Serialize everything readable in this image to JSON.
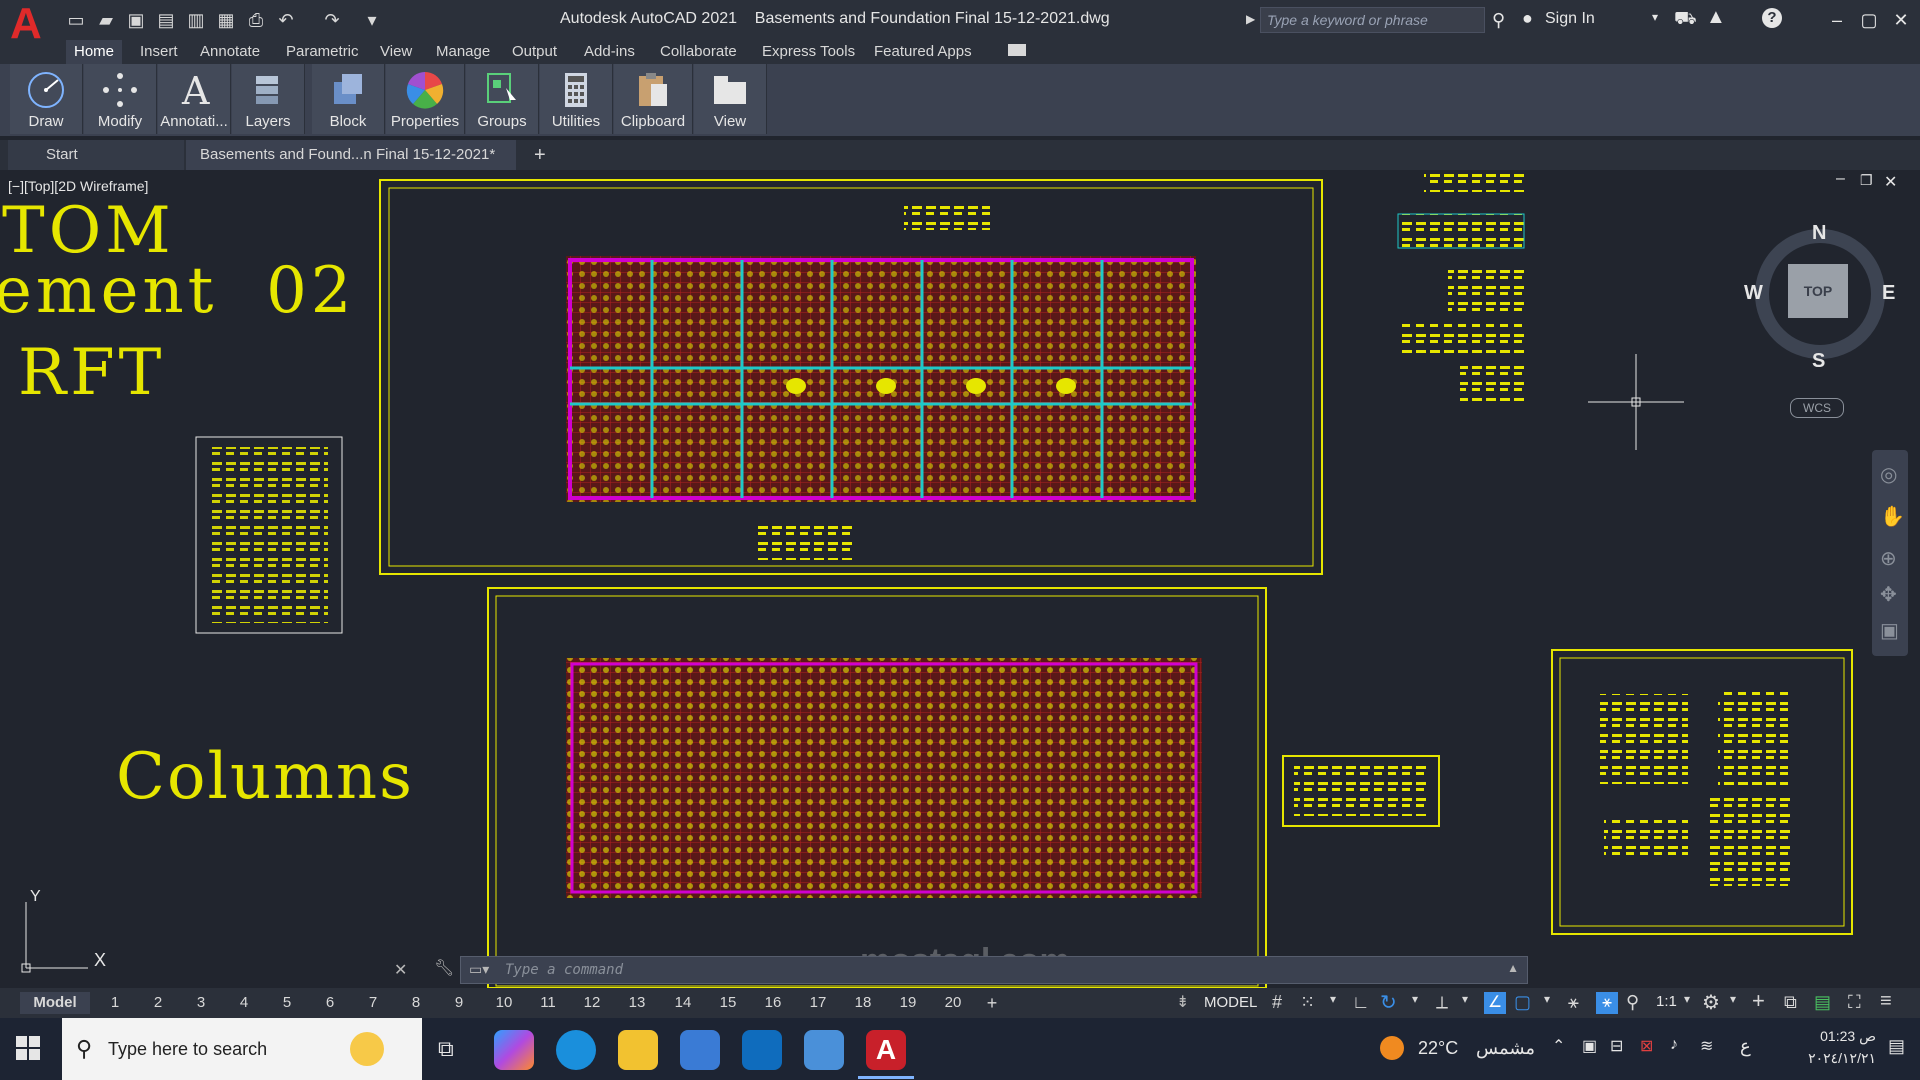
{
  "titlebar": {
    "app_title": "Autodesk AutoCAD 2021",
    "file_title": "Basements and Foundation Final 15-12-2021.dwg",
    "search_placeholder": "Type a keyword or phrase",
    "signin": "Sign In"
  },
  "ribbon_tabs": [
    "Home",
    "Insert",
    "Annotate",
    "Parametric",
    "View",
    "Manage",
    "Output",
    "Add-ins",
    "Collaborate",
    "Express Tools",
    "Featured Apps"
  ],
  "ribbon_panels": [
    {
      "label": "Draw",
      "icon": "draw-icon"
    },
    {
      "label": "Modify",
      "icon": "modify-icon"
    },
    {
      "label": "Annotati...",
      "icon": "annotation-icon"
    },
    {
      "label": "Layers",
      "icon": "layers-icon"
    },
    {
      "label": "Block",
      "icon": "block-icon"
    },
    {
      "label": "Properties",
      "icon": "properties-icon"
    },
    {
      "label": "Groups",
      "icon": "groups-icon"
    },
    {
      "label": "Utilities",
      "icon": "utilities-icon"
    },
    {
      "label": "Clipboard",
      "icon": "clipboard-icon"
    },
    {
      "label": "View",
      "icon": "view-icon"
    }
  ],
  "file_tabs": {
    "start": "Start",
    "active": "Basements and Found...n Final 15-12-2021*"
  },
  "viewport": {
    "label": "[−][Top][2D Wireframe]",
    "drawing_text_1": "TOM",
    "drawing_text_2": "ement  02",
    "drawing_text_3": "RFT",
    "drawing_text_4": "Columns"
  },
  "viewcube": {
    "n": "N",
    "s": "S",
    "e": "E",
    "w": "W",
    "top": "TOP",
    "wcs": "WCS"
  },
  "ucs": {
    "x": "X",
    "y": "Y"
  },
  "command_placeholder": "Type a command",
  "layout_tabs": [
    "Model",
    "1",
    "2",
    "3",
    "4",
    "5",
    "6",
    "7",
    "8",
    "9",
    "10",
    "11",
    "12",
    "13",
    "14",
    "15",
    "16",
    "17",
    "18",
    "19",
    "20"
  ],
  "status": {
    "model": "MODEL",
    "scale": "1:1"
  },
  "taskbar": {
    "search_placeholder": "Type here to search",
    "weather": "22°C",
    "weather_desc": "مشمس",
    "lang": "ع",
    "time": "01:23 ص",
    "date": "٢٠٢٤/١٢/٢١"
  },
  "watermark": "mostaql.com",
  "colors": {
    "drawing_yellow": "#e6e600",
    "drawing_magenta": "#d000d0",
    "drawing_red": "#8a1e1e",
    "accent_blue": "#3a8ee6"
  }
}
